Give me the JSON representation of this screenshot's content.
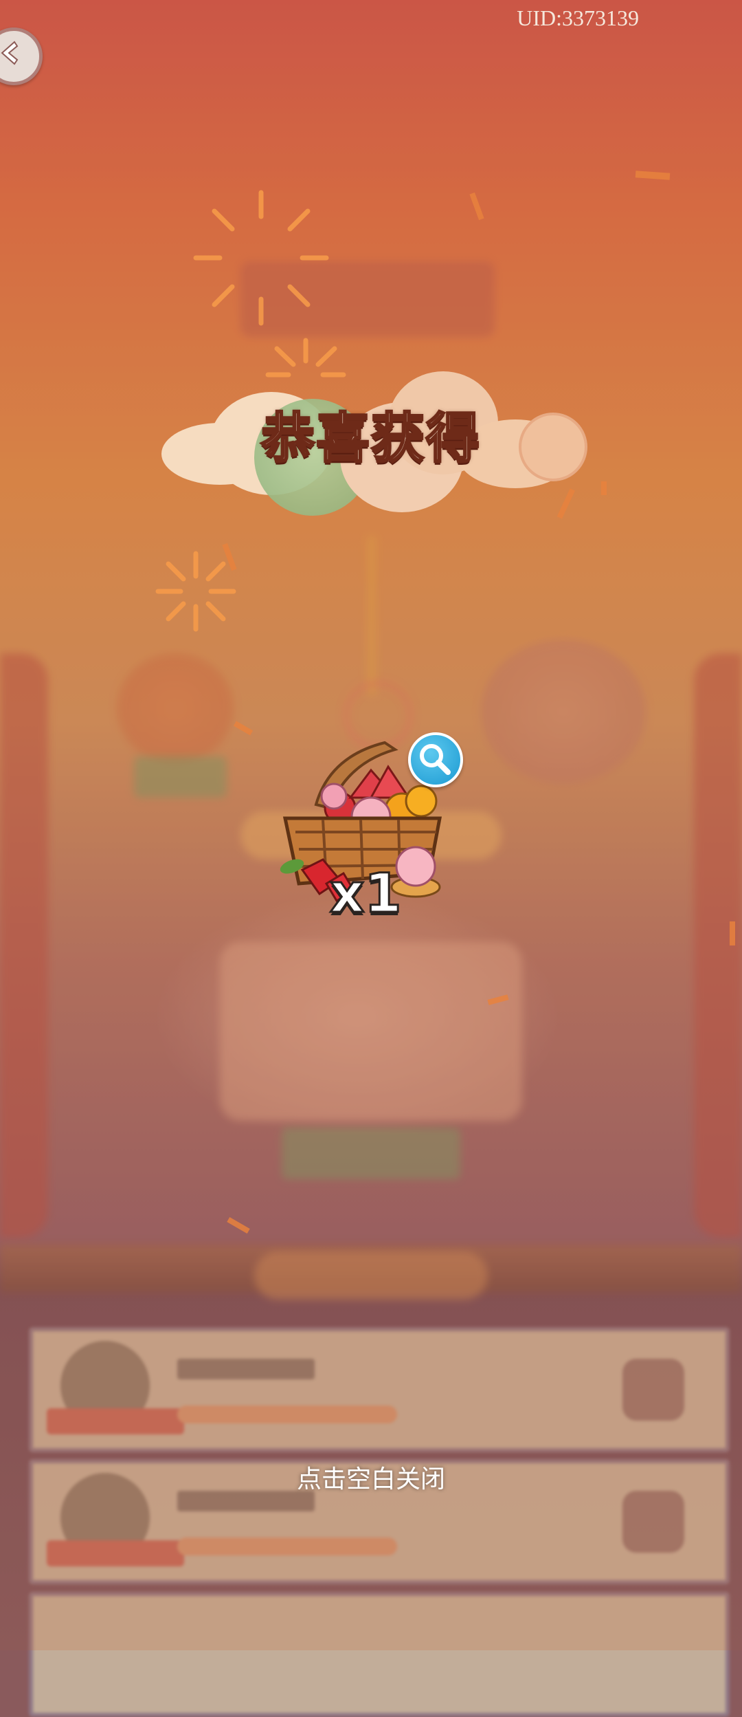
{
  "header": {
    "uid_text": "UID:3373139"
  },
  "popup": {
    "title": "恭喜获得",
    "reward": {
      "icon": "fruit-basket-icon",
      "quantity_text": "x1"
    },
    "close_hint": "点击空白关闭"
  },
  "icons": {
    "back": "back-arrow-icon",
    "preview": "magnifier-icon"
  },
  "colors": {
    "title_fill": "#f7e7d2",
    "title_stroke": "#6e2a18",
    "magnifier_blue": "#1c9ad2",
    "firework_orange": "#f59a4a"
  }
}
